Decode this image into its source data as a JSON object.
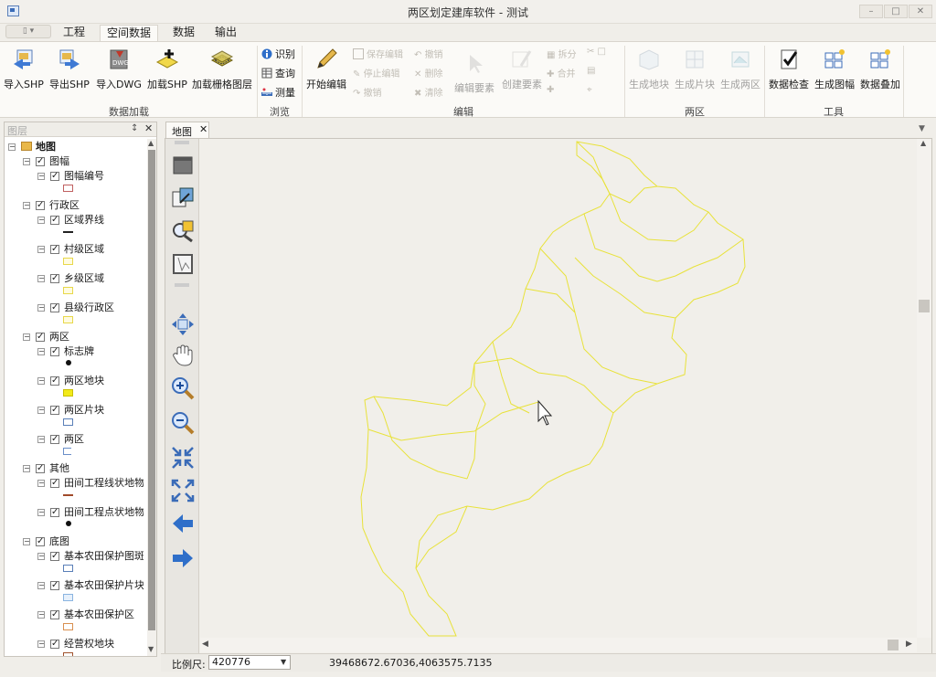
{
  "window": {
    "title": "两区划定建库软件 - 测试"
  },
  "ribbon_tabs": [
    {
      "label": "工程"
    },
    {
      "label": "空间数据"
    },
    {
      "label": "数据"
    },
    {
      "label": "输出"
    }
  ],
  "active_tab": "空间数据",
  "groups": {
    "data_load": {
      "label": "数据加载",
      "buttons": [
        "导入SHP",
        "导出SHP",
        "导入DWG",
        "加载SHP",
        "加载栅格图层"
      ]
    },
    "browse": {
      "label": "浏览",
      "buttons": [
        "识别",
        "查询",
        "测量"
      ]
    },
    "edit": {
      "label": "编辑",
      "start": "开始编辑",
      "small_buttons": [
        "保存编辑",
        "撤销",
        "停止编辑",
        "删除",
        "撤销",
        "清除",
        "编辑要素",
        "创建要素",
        "拆分",
        "合并"
      ]
    },
    "two_zones": {
      "label": "两区",
      "buttons": [
        "生成地块",
        "生成片块",
        "生成两区"
      ]
    },
    "tools": {
      "label": "工具",
      "buttons": [
        "数据检查",
        "生成图幅",
        "数据叠加"
      ]
    }
  },
  "layer_panel": {
    "title": "图层",
    "tree": [
      {
        "label": "地图",
        "level": 0
      },
      {
        "label": "图幅",
        "level": 1
      },
      {
        "label": "图幅编号",
        "level": 2,
        "symbol": "rect-empty"
      },
      {
        "label": "行政区",
        "level": 1
      },
      {
        "label": "区域界线",
        "level": 2,
        "symbol": "dashline"
      },
      {
        "label": "村级区域",
        "level": 2,
        "symbol": "rect-yellow-outline"
      },
      {
        "label": "乡级区域",
        "level": 2,
        "symbol": "rect-yellow-outline"
      },
      {
        "label": "县级行政区",
        "level": 2,
        "symbol": "rect-yellow-outline"
      },
      {
        "label": "两区",
        "level": 1
      },
      {
        "label": "标志牌",
        "level": 2,
        "symbol": "dot"
      },
      {
        "label": "两区地块",
        "level": 2,
        "symbol": "rect-yellow"
      },
      {
        "label": "两区片块",
        "level": 2,
        "symbol": "rect-blue-outline"
      },
      {
        "label": "两区",
        "level": 2,
        "symbol": "bracket"
      },
      {
        "label": "其他",
        "level": 1
      },
      {
        "label": "田间工程线状地物",
        "level": 2,
        "symbol": "line-brown"
      },
      {
        "label": "田间工程点状地物",
        "level": 2,
        "symbol": "dot"
      },
      {
        "label": "底图",
        "level": 1
      },
      {
        "label": "基本农田保护图斑",
        "level": 2,
        "symbol": "rect-blue-outline"
      },
      {
        "label": "基本农田保护片块",
        "level": 2,
        "symbol": "rect-lightblue"
      },
      {
        "label": "基本农田保护区",
        "level": 2,
        "symbol": "rect-orange-outline"
      },
      {
        "label": "经营权地块",
        "level": 2,
        "symbol": "rect-brown-outline"
      }
    ]
  },
  "map": {
    "tab_label": "地图",
    "boundary_color": "#e8e23a"
  },
  "status": {
    "scale_label": "比例尺:",
    "scale_value": "420776",
    "coords": "39468672.67036,4063575.7135"
  }
}
